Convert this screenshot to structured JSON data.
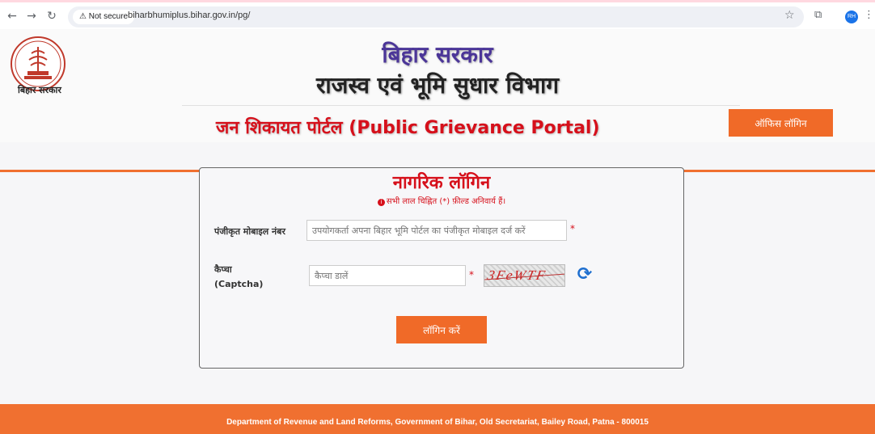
{
  "browser": {
    "back_icon": "←",
    "forward_icon": "→",
    "reload_icon": "↻",
    "not_secure": "⚠ Not secure",
    "url": "biharbhumiplus.bihar.gov.in/pg/",
    "star_icon": "☆",
    "extensions_icon": "⧉",
    "profile_initials": "RH",
    "menu_icon": "⋮"
  },
  "header": {
    "emblem_caption": "बिहार सरकार",
    "title_line1": "बिहार सरकार",
    "title_line2": "राजस्व एवं भूमि सुधार विभाग",
    "portal_title": "जन शिकायत पोर्टल (Public Grievance Portal)",
    "office_login_label": "ऑफिस लॉगिन"
  },
  "login_card": {
    "title": "नागरिक लॉगिन",
    "note": "सभी लाल चिह्नित (*) फ़ील्ड अनिवार्य हैं।",
    "info_icon": "i",
    "mobile_label": "पंजीकृत मोबाइल नंबर",
    "mobile_placeholder": "उपयोगकर्ता अपना बिहार भूमि पोर्टल का पंजीकृत मोबाइल दर्ज करें",
    "captcha_label_hi": "कैप्चा",
    "captcha_label_en": "(Captcha)",
    "captcha_placeholder": "कैप्चा डालें",
    "captcha_text": "3FeWTF",
    "required_mark": "*",
    "refresh_icon": "⟳",
    "login_button": "लॉगिन करें"
  },
  "footer": {
    "line1": "Department of Revenue and Land Reforms, Government of Bihar, Old Secretariat, Bailey Road, Patna - 800015"
  },
  "colors": {
    "accent_orange": "#f06a28",
    "title_red": "#d6101b",
    "title_purple": "#4b3598"
  }
}
